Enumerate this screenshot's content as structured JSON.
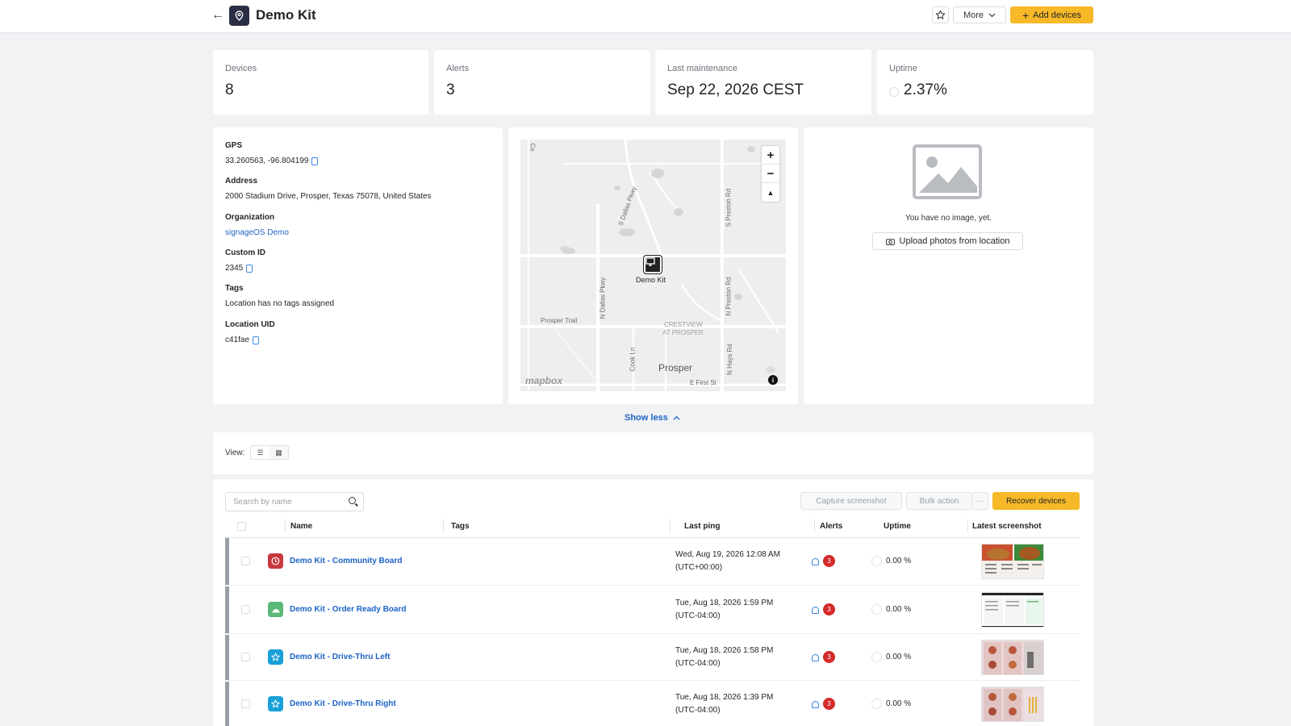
{
  "header": {
    "title": "Demo Kit",
    "more_label": "More",
    "add_devices_label": "Add devices"
  },
  "stats": [
    {
      "label": "Devices",
      "value": "8"
    },
    {
      "label": "Alerts",
      "value": "3"
    },
    {
      "label": "Last maintenance",
      "value": "Sep 22, 2026 CEST"
    },
    {
      "label": "Uptime",
      "value": "2.37%"
    }
  ],
  "info": {
    "gps_label": "GPS",
    "gps_value": "33.260563, -96.804199",
    "address_label": "Address",
    "address_value": "2000 Stadium Drive, Prosper, Texas 75078, United States",
    "organization_label": "Organization",
    "organization_value": "signageOS Demo",
    "custom_id_label": "Custom ID",
    "custom_id_value": "2345",
    "tags_label": "Tags",
    "tags_value": "Location has no tags assigned",
    "uid_label": "Location UID",
    "uid_value": "c41fae"
  },
  "map": {
    "marker_label": "Demo Kit",
    "attribution": "mapbox",
    "street_labels": [
      "S Dallas Pkwy",
      "N Dallas Pkwy",
      "S Preston Rd",
      "N Preston Rd",
      "Prosper Trail",
      "CRESTVIEW",
      "AT PROSPER",
      "Prosper",
      "E First St",
      "Cook Ln",
      "N Hays Rd",
      "Co"
    ]
  },
  "image_panel": {
    "empty_text": "You have no image, yet.",
    "upload_label": "Upload photos from location"
  },
  "show_less_label": "Show less",
  "view": {
    "label": "View:"
  },
  "devices_table": {
    "search_placeholder": "Search by name",
    "capture_label": "Capture screenshot",
    "bulk_label": "Bulk action",
    "bulk_more": "···",
    "recover_label": "Recover devices",
    "columns": [
      "Name",
      "Tags",
      "Last ping",
      "Alerts",
      "Uptime",
      "Latest screenshot"
    ],
    "rows": [
      {
        "name": "Demo Kit - Community Board",
        "ping_date": "Wed, Aug 19, 2026 12:08 AM",
        "ping_tz": "(UTC+00:00)",
        "alerts": "3",
        "uptime": "0.00 %",
        "platform_icon": "webos-icon",
        "icon_color": "#c8383e"
      },
      {
        "name": "Demo Kit - Order Ready Board",
        "ping_date": "Tue, Aug 18, 2026 1:59 PM",
        "ping_tz": "(UTC-04:00)",
        "alerts": "3",
        "uptime": "0.00 %",
        "platform_icon": "android-icon",
        "icon_color": "#5cb878"
      },
      {
        "name": "Demo Kit - Drive-Thru Left",
        "ping_date": "Tue, Aug 18, 2026 1:58 PM",
        "ping_tz": "(UTC-04:00)",
        "alerts": "3",
        "uptime": "0.00 %",
        "platform_icon": "player-icon",
        "icon_color": "#1aa0d8"
      },
      {
        "name": "Demo Kit - Drive-Thru Right",
        "ping_date": "Tue, Aug 18, 2026 1:39 PM",
        "ping_tz": "(UTC-04:00)",
        "alerts": "3",
        "uptime": "0.00 %",
        "platform_icon": "player-icon",
        "icon_color": "#1aa0d8"
      }
    ]
  },
  "colors": {
    "accent": "#f7b928",
    "link": "#1d63c5",
    "alert_badge": "#d42a2a",
    "title_badge": "#2b2f45"
  }
}
